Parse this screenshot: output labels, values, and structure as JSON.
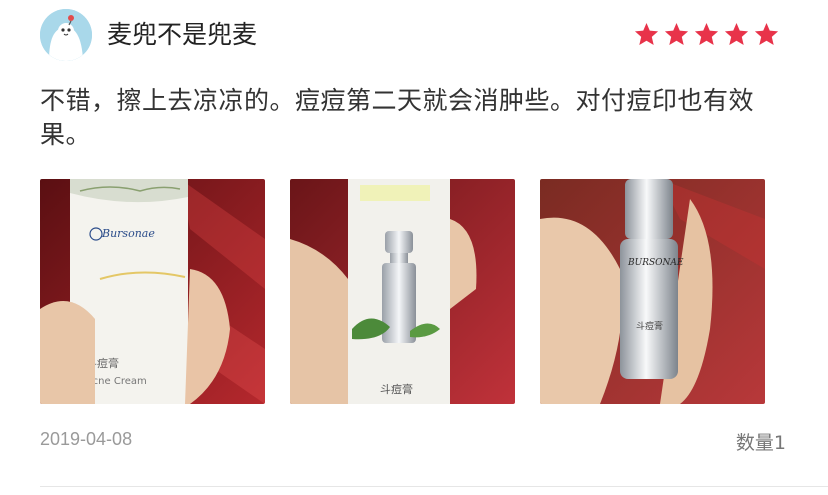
{
  "reviewer": {
    "name": "麦兜不是兜麦",
    "avatar_icon": "penguin-avatar-icon"
  },
  "rating": {
    "stars": 5,
    "max": 5,
    "color": "#e8334a"
  },
  "review": {
    "text": "不错，擦上去凉凉的。痘痘第二天就会消肿些。对付痘印也有效果。"
  },
  "photos": [
    {
      "brand": "Bursonae",
      "product_cn": "斗痘膏",
      "product_en": "Acne Cream"
    },
    {
      "product_cn": "斗痘膏"
    },
    {
      "brand": "BURSONAE",
      "product_cn": "斗痘膏"
    }
  ],
  "footer": {
    "date": "2019-04-08",
    "quantity": "数量1"
  }
}
